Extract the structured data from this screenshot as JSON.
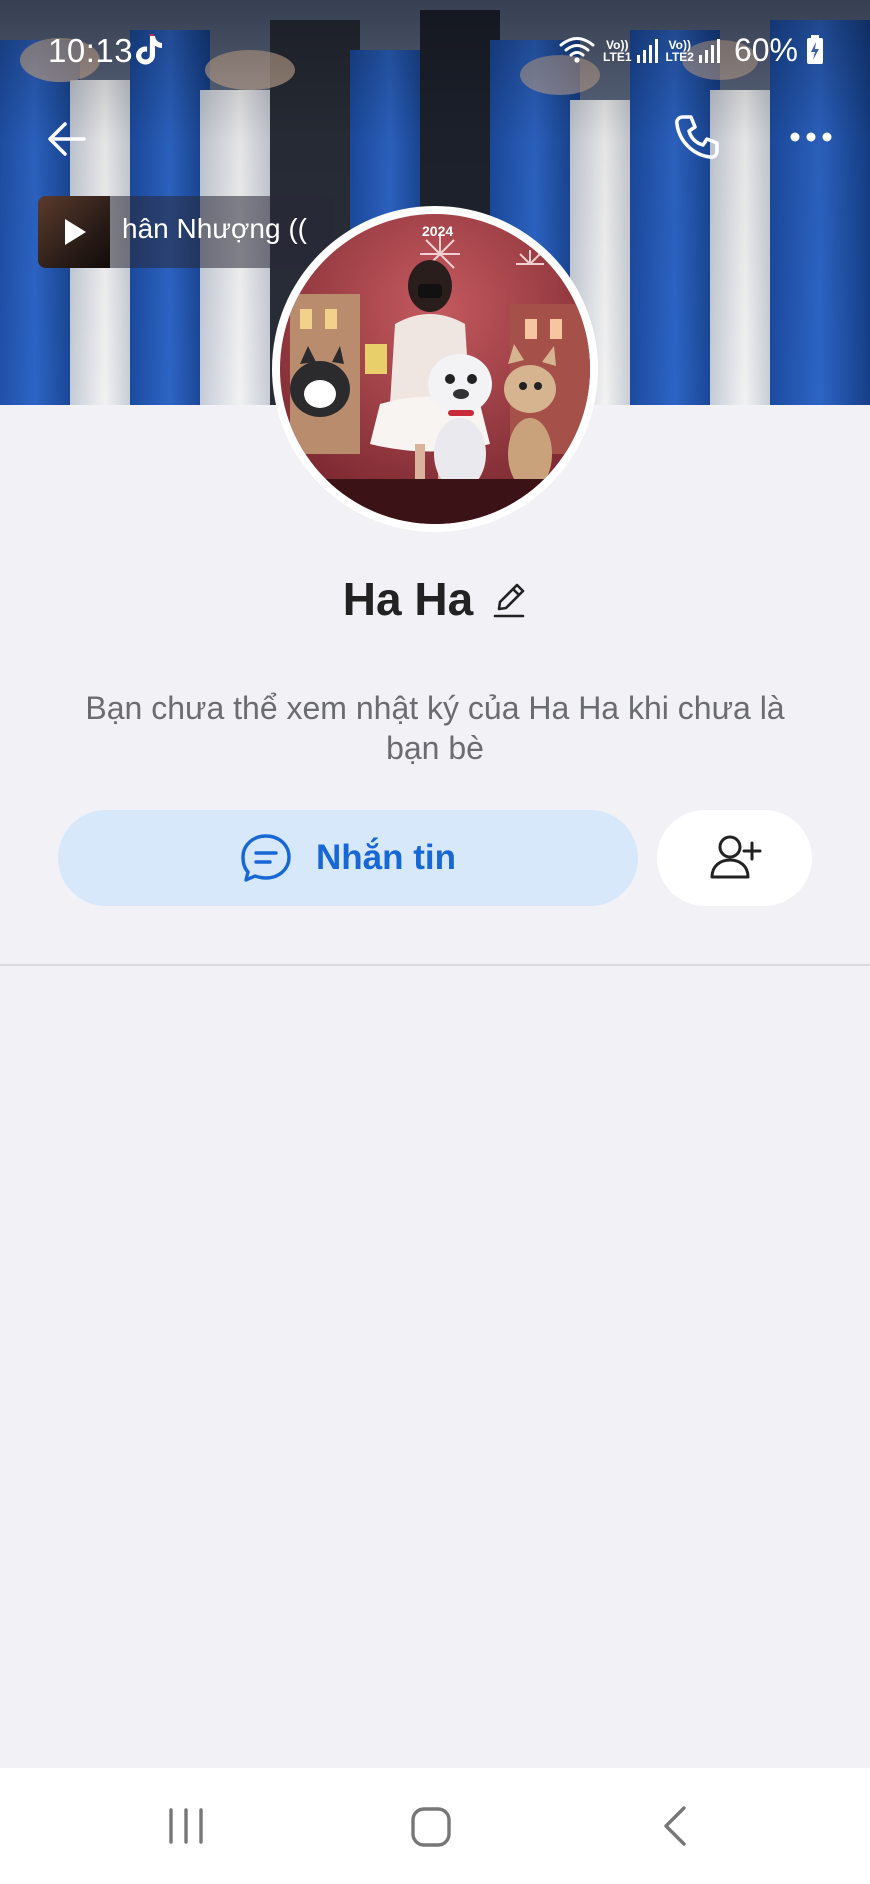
{
  "status_bar": {
    "time": "10:13",
    "sim1": "Vo))\nLTE1",
    "sim1_top": "Vo))",
    "sim1_bottom": "LTE1",
    "sim2_top": "Vo))",
    "sim2_bottom": "LTE2",
    "battery": "60%"
  },
  "music": {
    "title": "hân Nhượng (("
  },
  "avatar": {
    "caption": "2024"
  },
  "profile": {
    "name": "Ha Ha",
    "notice": "Bạn chưa thể xem nhật ký của Ha Ha khi chưa là bạn bè"
  },
  "actions": {
    "message_label": "Nhắn tin"
  },
  "icons": {
    "back": "arrow-left-icon",
    "call": "phone-icon",
    "more": "more-horizontal-icon",
    "edit": "pencil-icon",
    "chat": "chat-bubble-icon",
    "add_friend": "add-friend-icon"
  },
  "colors": {
    "accent": "#1767d6",
    "message_button_bg": "#d8e8fb",
    "page_bg": "#f1f1f6"
  }
}
